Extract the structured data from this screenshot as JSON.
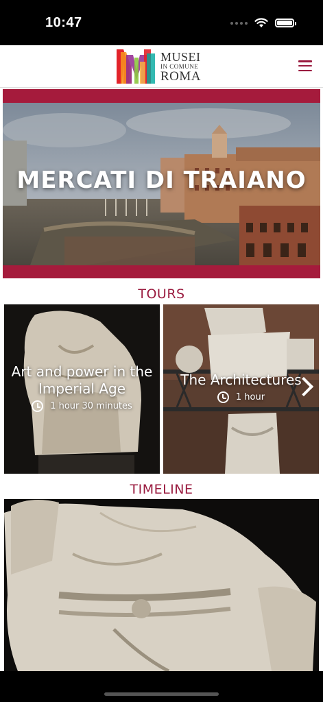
{
  "status_bar": {
    "time": "10:47"
  },
  "header": {
    "logo": {
      "line1": "MUSEI",
      "line2": "IN COMUNE",
      "line3": "ROMA"
    },
    "menu_icon": "hamburger-menu-icon",
    "accent_color": "#9a1b3f"
  },
  "hero": {
    "title": "MERCATI DI TRAIANO",
    "band_color": "#a51b3c"
  },
  "tours": {
    "section_title": "TOURS",
    "items": [
      {
        "title": "Art and power in the Imperial Age",
        "duration": "1 hour 30 minutes"
      },
      {
        "title": "The Architectures",
        "duration": "1 hour"
      }
    ]
  },
  "timeline": {
    "section_title": "TIMELINE"
  }
}
